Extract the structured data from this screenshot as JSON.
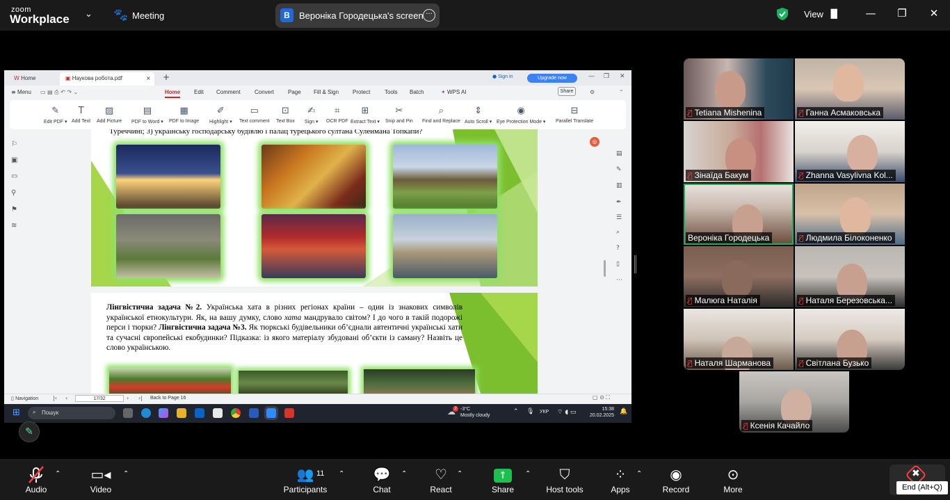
{
  "zoom": {
    "logo_top": "zoom",
    "logo_bottom": "Workplace",
    "meeting_label": "Meeting",
    "share_initial": "B",
    "share_title": "Вероніка Городецька's screen",
    "view_label": "View"
  },
  "doc": {
    "tab_home": "Home",
    "tab_file": "Наукова робота.pdf",
    "sign_in": "Sign in",
    "upgrade": "Upgrade now",
    "menu": "Menu",
    "menu_tabs": [
      "Home",
      "Edit",
      "Comment",
      "Convert",
      "Page",
      "Fill & Sign",
      "Protect",
      "Tools",
      "Batch",
      "WPS AI"
    ],
    "share_btn": "Share",
    "ribbon": [
      "Edit PDF",
      "Add Text",
      "Add Picture",
      "PDF to Word",
      "PDF to Image",
      "Highlight",
      "Text comment",
      "Text Box",
      "Sign",
      "OCR PDF",
      "Extract Text",
      "Snip and Pin",
      "Find and Replace",
      "Auto Scroll",
      "Eye Protection Mode",
      "Parallel Translate"
    ],
    "page1_top_text": "Туреччині; 3) українську господарську будівлю і палац турецького султана Сулеймана Топкапи?",
    "page2_title1": "Лінгвістична задача №2.",
    "page2_text1": " Українська хата в різних регіонах країни – один із знакових символів української етнокультури. Як, на вашу думку, слово ",
    "page2_italic": "хата",
    "page2_text2": " мандрувало світом? І до чого в такій подорожі перси і тюрки? ",
    "page2_title2": "Лінгвістична задача №3.",
    "page2_text3": " Як тюркські будівельники об’єднали автентичні українські хати та сучасні європейські екобудинки? Підказка: із якого матеріалу збудовані об’єкти із саману? Назвіть це слово українською.",
    "status_nav": "Navigation",
    "page_num": "17/32",
    "back_to": "Back to Page 16"
  },
  "taskbar": {
    "search": "Пошук",
    "weather_temp": "-3°C",
    "weather_desc": "Mostly cloudy",
    "weather_badge": "2",
    "lang": "УКР",
    "time": "15:38",
    "date": "20.02.2025"
  },
  "participants": [
    {
      "name": "Tetiana Mishenina",
      "muted": true
    },
    {
      "name": "Ганна Асмаковська",
      "muted": true
    },
    {
      "name": "Зінаїда Бакум",
      "muted": true
    },
    {
      "name": "Zhanna Vasylivna Kol...",
      "muted": true
    },
    {
      "name": "Вероніка Городецька",
      "muted": false
    },
    {
      "name": "Людмила Білоконенко",
      "muted": true
    },
    {
      "name": "Малюга Наталія",
      "muted": true
    },
    {
      "name": "Наталя Березовська...",
      "muted": true
    },
    {
      "name": "Наталя Шарманова",
      "muted": true
    },
    {
      "name": "Світлана Бузько",
      "muted": true
    },
    {
      "name": "Ксенія Качайло",
      "muted": true
    }
  ],
  "toolbar": {
    "audio": "Audio",
    "video": "Video",
    "participants": "Participants",
    "participants_count": "11",
    "chat": "Chat",
    "react": "React",
    "share": "Share",
    "host_tools": "Host tools",
    "apps": "Apps",
    "record": "Record",
    "more": "More",
    "end_tooltip": "End (Alt+Q)"
  },
  "colors": {
    "accent_green": "#19b35d",
    "share_green": "#1fbf4f",
    "mute_red": "#ff3b3b",
    "wps_red": "#c62828"
  }
}
